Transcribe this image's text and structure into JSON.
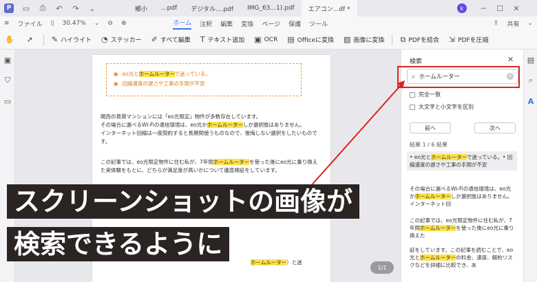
{
  "titlebar": {
    "tabs": [
      {
        "label": "鄉小",
        "active": false
      },
      {
        "label": "...pdf",
        "active": false
      },
      {
        "label": "デジタル....pdf",
        "active": false
      },
      {
        "label": "IMG_63...1).pdf",
        "active": false
      },
      {
        "label": "エアコン...df *",
        "active": true
      }
    ],
    "avatar_letter": "k",
    "app_logo_letter": "P"
  },
  "menubar": {
    "file": "ファイル",
    "zoom": "30.47%",
    "tabs": [
      "ホーム",
      "注釈",
      "編集",
      "変換",
      "ページ",
      "保護",
      "ツール"
    ],
    "active_tab": "ホーム",
    "share": "共有"
  },
  "toolbar": {
    "highlight": "ハイライト",
    "sticker": "ステッカー",
    "edit_all": "すべて編集",
    "add_text": "テキスト追加",
    "ocr": "OCR",
    "office": "Officeに変換",
    "to_image": "画像に変換",
    "combine": "PDFを結合",
    "compress": "PDFを圧縮"
  },
  "document": {
    "bullets": [
      {
        "before": "eo光と",
        "hl": "ホームルーター",
        "after": "で迷っている。"
      },
      {
        "before": "回線速度の遅さや工事の手間が不安",
        "hl": "",
        "after": ""
      }
    ],
    "para1": [
      {
        "before": "関西の賃貸マンションには「eo光限定」物件が多数存在しています。",
        "hl": "",
        "after": ""
      },
      {
        "before": "その場合に選べるWi-Fiの通信環境は、eo光か",
        "hl": "ホームルーター",
        "after": "しか選択肢はありません。"
      },
      {
        "before": "インターネット回線は一度契約すると長期間使うものなので、後悔しない選択をしたいもので",
        "hl": "",
        "after": ""
      },
      {
        "before": "す。",
        "hl": "",
        "after": ""
      }
    ],
    "para2": [
      {
        "before": "この記事では、eo光限定物件に住む私が、7年間",
        "hl": "ホームルーター",
        "after": "を使った後にeo光に乗り換え"
      },
      {
        "before": "た実体験をもとに、どちらが満足度が高いかについて徹底検証をしています。",
        "hl": "",
        "after": ""
      }
    ],
    "bottom_line": {
      "before": "",
      "hl": "ホームルーター",
      "after": "）と迷"
    },
    "page_indicator": "1/1"
  },
  "search_panel": {
    "title": "検索",
    "query": "ホームルーター",
    "opt_exact": "完全一致",
    "opt_case": "大文字と小文字を区別",
    "prev": "前へ",
    "next": "次へ",
    "count": "結果 1 / 6 結果",
    "results": [
      {
        "text_before": "• eo光と",
        "hl": "ホームルーター",
        "text_after": "で迷っている。• 回線速度の遅さや工事の手間が不安",
        "selected": true
      },
      {
        "text_before": "その場合に選べるWi-Fiの通信環境は、eo光か",
        "hl": "ホームルーター",
        "text_after": "しか選択肢はありません。インターネット回",
        "selected": false
      },
      {
        "text_before": "この記事では、eo光限定物件に住む私が、7年間",
        "hl": "ホームルーター",
        "text_after": "を使った後にeo光に乗り換えた",
        "selected": false
      },
      {
        "text_before": "証をしています。この記事を読むことで、eo光と",
        "hl": "ホームルーター",
        "text_after": "の料金、速度、解約リスクなどを詳細に比較でき、あ",
        "selected": false
      }
    ]
  },
  "overlay": {
    "line1": "スクリーンショットの画像が",
    "line2": "検索できるように"
  },
  "colors": {
    "accent": "#3a73e8",
    "highlight": "#ffe24a",
    "callout_red": "#e02020",
    "overlay_bg": "#2a2423",
    "dash_orange": "#f09a3b"
  }
}
